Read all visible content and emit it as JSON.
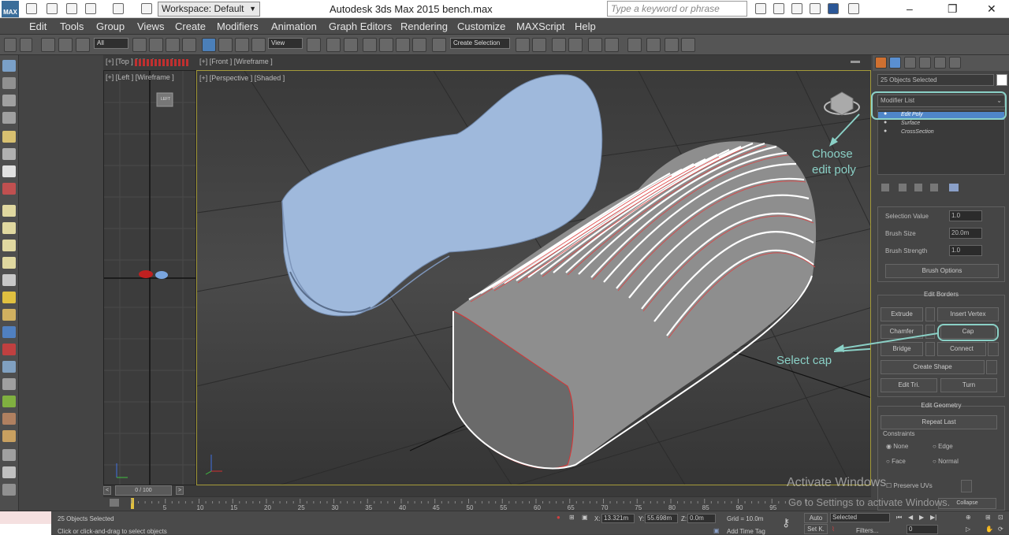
{
  "title": {
    "app_label": "MAX",
    "workspace": "Workspace: Default",
    "window_title": "Autodesk 3ds Max  2015     bench.max",
    "search_placeholder": "Type a keyword or phrase"
  },
  "menu": [
    "Edit",
    "Tools",
    "Group",
    "Views",
    "Create",
    "Modifiers",
    "Animation",
    "Graph Editors",
    "Rendering",
    "Customize",
    "MAXScript",
    "Help"
  ],
  "toolbar": {
    "filter_value": "All",
    "ref_coord_value": "View",
    "named_selection_value": "Create Selection"
  },
  "viewports": {
    "top_label": "[+] [Top ] [Wireframe ]",
    "front_label": "[+] [Front ] [Wireframe ]",
    "left_label": "[+] [Left ] [Wireframe ]",
    "persp_label": "[+] [Perspective ] [Shaded ]",
    "left_cube_label": "LEFT"
  },
  "command_panel": {
    "selection_name": "25 Objects Selected",
    "modifier_list": "Modifier List",
    "stack_items": [
      "Edit Poly",
      "Surface",
      "CrossSection"
    ],
    "paint": {
      "selection_value_label": "Selection Value",
      "selection_value": "1.0",
      "brush_size_label": "Brush Size",
      "brush_size": "20.0m",
      "brush_strength_label": "Brush Strength",
      "brush_strength": "1.0",
      "brush_options": "Brush Options"
    },
    "edit_borders": {
      "title": "Edit Borders",
      "extrude": "Extrude",
      "insert_vertex": "Insert Vertex",
      "chamfer": "Chamfer",
      "cap": "Cap",
      "bridge": "Bridge",
      "connect": "Connect",
      "create_shape": "Create Shape",
      "edit_tri": "Edit Tri.",
      "turn": "Turn"
    },
    "edit_geometry": {
      "title": "Edit Geometry",
      "repeat_last": "Repeat Last",
      "constraints": "Constraints",
      "none": "None",
      "edge": "Edge",
      "face": "Face",
      "normal": "Normal",
      "preserve_uvs": "Preserve UVs",
      "collapse": "Collapse"
    }
  },
  "callouts": {
    "choose_1": "Choose",
    "choose_2": "edit poly",
    "select_cap": "Select cap",
    "color": "#8ad0c6"
  },
  "timeline": {
    "frame": "0 / 100",
    "ticks": [
      "5",
      "10",
      "15",
      "20",
      "25",
      "30",
      "35",
      "40",
      "45",
      "50",
      "55",
      "60",
      "65",
      "70",
      "75",
      "80",
      "85",
      "90",
      "95"
    ]
  },
  "status": {
    "selected": "25 Objects Selected",
    "prompt": "Click or click-and-drag to select objects",
    "x_label": "X:",
    "x_value": "13.321m",
    "y_label": "Y:",
    "y_value": "55.698m",
    "z_label": "Z:",
    "z_value": "0.0m",
    "grid": "Grid = 10.0m",
    "add_time_tag": "Add Time Tag",
    "auto": "Auto",
    "set_key": "Set K.",
    "selected_dd": "Selected",
    "filters": "Filters...",
    "frame_field": "0"
  },
  "watermark": {
    "line1": "Activate Windows",
    "line2": "Go to Settings to activate Windows."
  }
}
